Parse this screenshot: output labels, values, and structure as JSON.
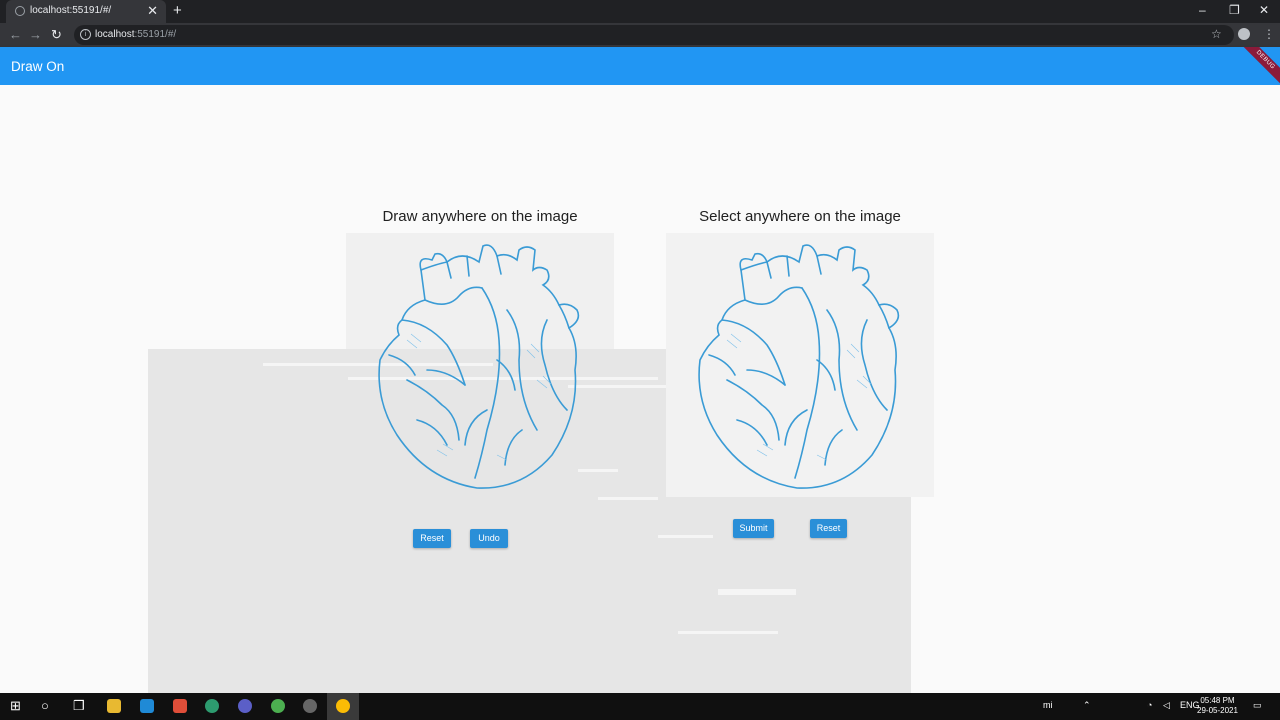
{
  "browser": {
    "tab_title": "localhost:55191/#/",
    "tab_close": "✕",
    "new_tab": "+",
    "url_host": "localhost",
    "url_rest": ":55191/#/",
    "back_icon": "←",
    "forward_icon": "→",
    "reload_icon": "↻",
    "star_icon": "☆",
    "menu_icon": "⋮",
    "minimize": "–",
    "restore": "❐",
    "close": "✕"
  },
  "appbar": {
    "title": "Draw On",
    "banner": "DEBUG",
    "color": "#2196f3"
  },
  "panels": {
    "left": {
      "title": "Draw anywhere on the image",
      "buttons": [
        "Reset",
        "Undo"
      ]
    },
    "right": {
      "title": "Select anywhere on the image",
      "buttons": [
        "Submit",
        "Reset"
      ]
    }
  },
  "accent": "#2a8fd8",
  "heart_color": "#3a9bd5",
  "taskbar": {
    "start_icon": "windows-icon",
    "search_icon": "circle-icon",
    "task_view_icon": "task-view-icon",
    "tray": [
      "ENG"
    ],
    "time": "05:48 PM",
    "date": "29-05-2021"
  }
}
